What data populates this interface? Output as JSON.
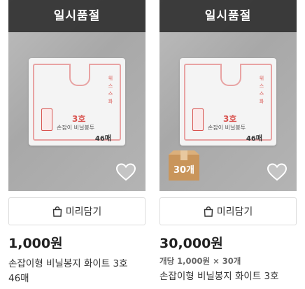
{
  "products": [
    {
      "soldout_label": "일시품절",
      "bag": {
        "size": "3호",
        "name": "손잡이 비닐봉투",
        "count": "46매",
        "side": "위 스 스 화"
      },
      "cart_button_label": "미리담기",
      "price": "1,000원",
      "name_line1": "손잡이형 비닐봉지 화이트 3호",
      "name_line2": "46매",
      "wishlist_icon": "heart-icon"
    },
    {
      "soldout_label": "일시품절",
      "bag": {
        "size": "3호",
        "name": "손잡이 비닐봉투",
        "count": "46매",
        "side": "위 스 스 화"
      },
      "quantity_badge": "30개",
      "cart_button_label": "미리담기",
      "price": "30,000원",
      "unit_price": "개당 1,000원 × 30개",
      "name_line1": "손잡이형 비닐봉지 화이트 3호",
      "wishlist_icon": "heart-icon"
    }
  ],
  "colors": {
    "soldout_bg": "#333333",
    "box_badge": "#c9955b",
    "accent_red": "#d9534f"
  }
}
